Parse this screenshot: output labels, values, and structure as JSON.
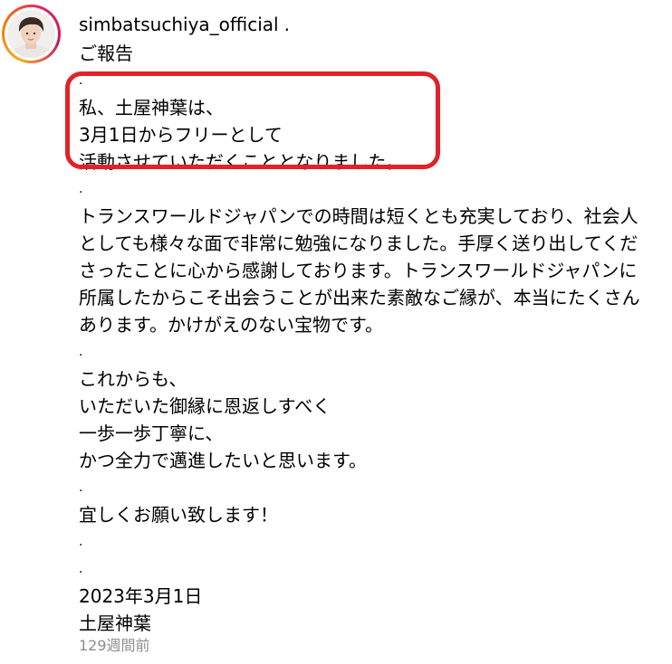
{
  "post": {
    "username": "simbatsuchiya_official",
    "name_suffix": ".",
    "caption": {
      "title": "ご報告",
      "dot1": ".",
      "hl_line1": "私、土屋神葉は、",
      "hl_line2": "3月1日からフリーとして",
      "hl_line3": "活動させていただくこととなりました。",
      "dot2": ".",
      "paragraph": "トランスワールドジャパンでの時間は短くとも充実しており、社会人としても様々な面で非常に勉強になりました。手厚く送り出してくださったことに心から感謝しております。トランスワールドジャパンに所属したからこそ出会うことが出来た素敵なご縁が、本当にたくさんあります。かけがえのない宝物です。",
      "dot3": ".",
      "line_a": "これからも、",
      "line_b": "いただいた御縁に恩返しすべく",
      "line_c": "一歩一歩丁寧に、",
      "line_d": "かつ全力で邁進したいと思います。",
      "dot4": ".",
      "closing": "宜しくお願い致します！",
      "dot5": ".",
      "dot6": ".",
      "date": "2023年3月1日",
      "signature": "土屋神葉"
    },
    "timestamp": "129週間前"
  },
  "colors": {
    "highlight_border": "#e0222a",
    "timestamp_text": "#8e8e8e",
    "avatar_ring": [
      "#f9a825",
      "#e91e63"
    ]
  }
}
